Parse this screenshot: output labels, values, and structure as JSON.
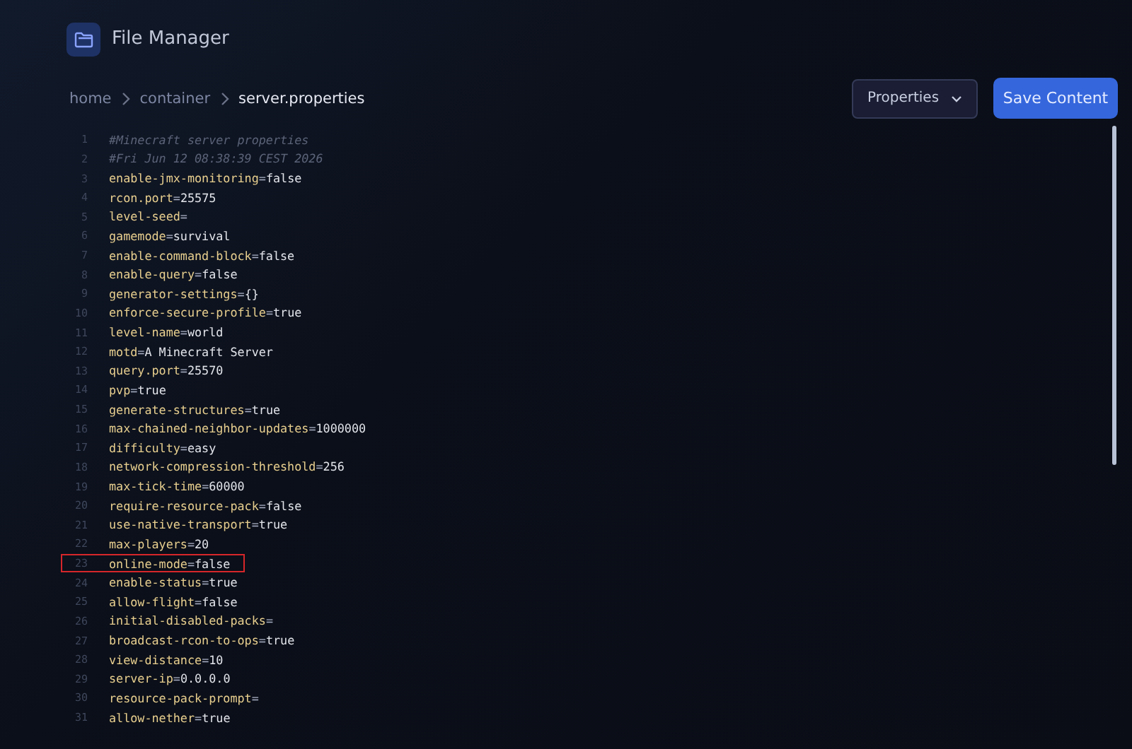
{
  "header": {
    "title": "File Manager"
  },
  "breadcrumb": [
    {
      "label": "home",
      "current": false
    },
    {
      "label": "container",
      "current": false
    },
    {
      "label": "server.properties",
      "current": true
    }
  ],
  "format_select": {
    "value": "Properties"
  },
  "save_button": {
    "label": "Save Content"
  },
  "editor": {
    "lines": [
      {
        "number": "1",
        "kind": "comment",
        "text": "#Minecraft server properties",
        "highlighted": false
      },
      {
        "number": "2",
        "kind": "comment",
        "text": "#Fri Jun 12 08:38:39 CEST 2026",
        "highlighted": false
      },
      {
        "number": "3",
        "kind": "property",
        "text": "enable-jmx-monitoring=false",
        "highlighted": false
      },
      {
        "number": "4",
        "kind": "property",
        "text": "rcon.port=25575",
        "highlighted": false
      },
      {
        "number": "5",
        "kind": "property",
        "text": "level-seed=",
        "highlighted": false
      },
      {
        "number": "6",
        "kind": "property",
        "text": "gamemode=survival",
        "highlighted": false
      },
      {
        "number": "7",
        "kind": "property",
        "text": "enable-command-block=false",
        "highlighted": false
      },
      {
        "number": "8",
        "kind": "property",
        "text": "enable-query=false",
        "highlighted": false
      },
      {
        "number": "9",
        "kind": "property",
        "text": "generator-settings={}",
        "highlighted": false
      },
      {
        "number": "10",
        "kind": "property",
        "text": "enforce-secure-profile=true",
        "highlighted": false
      },
      {
        "number": "11",
        "kind": "property",
        "text": "level-name=world",
        "highlighted": false
      },
      {
        "number": "12",
        "kind": "property",
        "text": "motd=A Minecraft Server",
        "highlighted": false
      },
      {
        "number": "13",
        "kind": "property",
        "text": "query.port=25570",
        "highlighted": false
      },
      {
        "number": "14",
        "kind": "property",
        "text": "pvp=true",
        "highlighted": false
      },
      {
        "number": "15",
        "kind": "property",
        "text": "generate-structures=true",
        "highlighted": false
      },
      {
        "number": "16",
        "kind": "property",
        "text": "max-chained-neighbor-updates=1000000",
        "highlighted": false
      },
      {
        "number": "17",
        "kind": "property",
        "text": "difficulty=easy",
        "highlighted": false
      },
      {
        "number": "18",
        "kind": "property",
        "text": "network-compression-threshold=256",
        "highlighted": false
      },
      {
        "number": "19",
        "kind": "property",
        "text": "max-tick-time=60000",
        "highlighted": false
      },
      {
        "number": "20",
        "kind": "property",
        "text": "require-resource-pack=false",
        "highlighted": false
      },
      {
        "number": "21",
        "kind": "property",
        "text": "use-native-transport=true",
        "highlighted": false
      },
      {
        "number": "22",
        "kind": "property",
        "text": "max-players=20",
        "highlighted": false
      },
      {
        "number": "23",
        "kind": "property",
        "text": "online-mode=false",
        "highlighted": true
      },
      {
        "number": "24",
        "kind": "property",
        "text": "enable-status=true",
        "highlighted": false
      },
      {
        "number": "25",
        "kind": "property",
        "text": "allow-flight=false",
        "highlighted": false
      },
      {
        "number": "26",
        "kind": "property",
        "text": "initial-disabled-packs=",
        "highlighted": false
      },
      {
        "number": "27",
        "kind": "property",
        "text": "broadcast-rcon-to-ops=true",
        "highlighted": false
      },
      {
        "number": "28",
        "kind": "property",
        "text": "view-distance=10",
        "highlighted": false
      },
      {
        "number": "29",
        "kind": "property",
        "text": "server-ip=0.0.0.0",
        "highlighted": false
      },
      {
        "number": "30",
        "kind": "property",
        "text": "resource-pack-prompt=",
        "highlighted": false
      },
      {
        "number": "31",
        "kind": "property",
        "text": "allow-nether=true",
        "highlighted": false
      }
    ]
  }
}
